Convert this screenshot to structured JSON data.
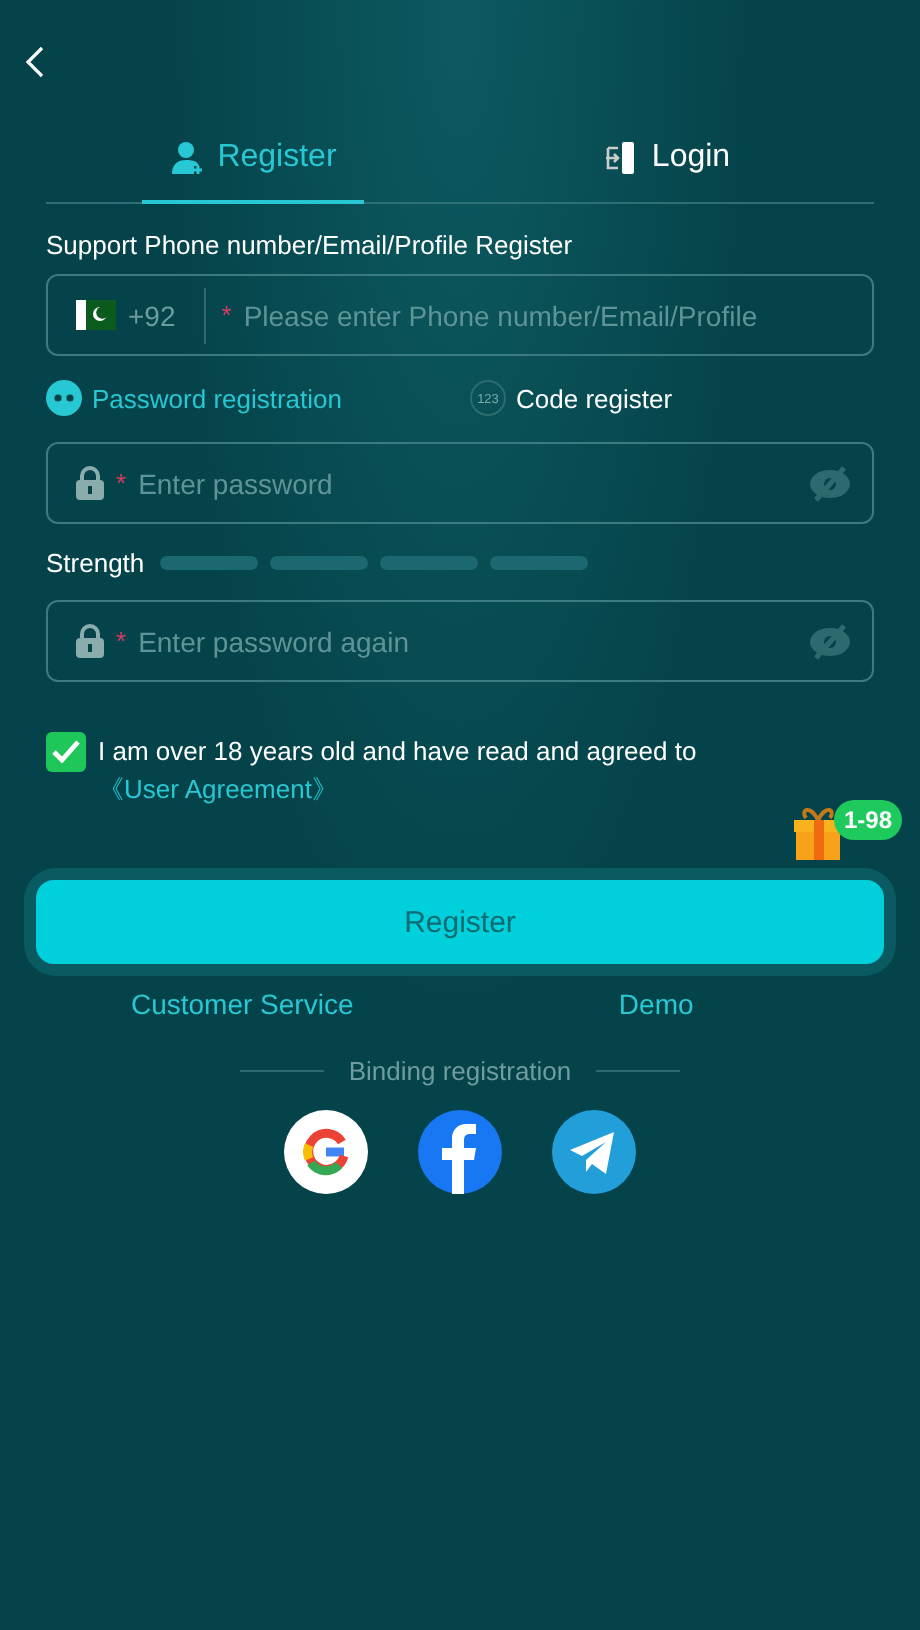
{
  "tabs": [
    {
      "label": "Register",
      "kind": "register",
      "selected": true
    },
    {
      "label": "Login",
      "kind": "login",
      "selected": false
    }
  ],
  "subtitle": "Support Phone number/Email/Profile Register",
  "phone_field": {
    "country_code": "+92",
    "required_mark": "*",
    "placeholder": "Please enter Phone number/Email/Profile"
  },
  "methods": [
    {
      "label": "Password registration",
      "kind": "password",
      "selected": true
    },
    {
      "label": "Code register",
      "kind": "code",
      "icon_text": "123",
      "selected": false
    }
  ],
  "password_field": {
    "required_mark": "*",
    "placeholder": "Enter password"
  },
  "strength_label": "Strength",
  "confirm_field": {
    "required_mark": "*",
    "placeholder": "Enter password again"
  },
  "agreement": {
    "checked": true,
    "text": "I am over 18 years old and have read and agreed to ",
    "link": "《User Agreement》"
  },
  "bonus_badge": "1-98",
  "register_button": "Register",
  "links": [
    "Customer Service",
    "Demo"
  ],
  "binding_label": "Binding registration"
}
